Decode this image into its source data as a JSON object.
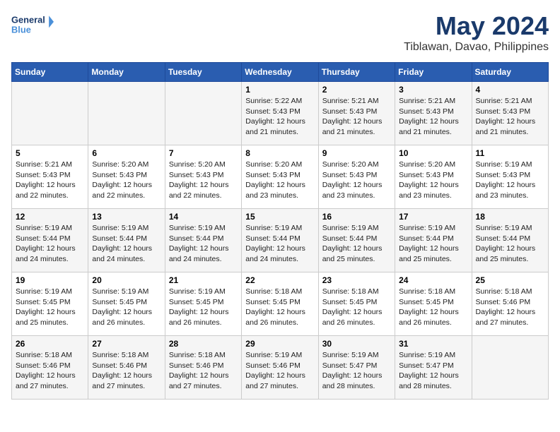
{
  "logo": {
    "line1": "General",
    "line2": "Blue"
  },
  "title": "May 2024",
  "location": "Tiblawan, Davao, Philippines",
  "weekdays": [
    "Sunday",
    "Monday",
    "Tuesday",
    "Wednesday",
    "Thursday",
    "Friday",
    "Saturday"
  ],
  "weeks": [
    [
      {
        "day": "",
        "content": ""
      },
      {
        "day": "",
        "content": ""
      },
      {
        "day": "",
        "content": ""
      },
      {
        "day": "1",
        "content": "Sunrise: 5:22 AM\nSunset: 5:43 PM\nDaylight: 12 hours\nand 21 minutes."
      },
      {
        "day": "2",
        "content": "Sunrise: 5:21 AM\nSunset: 5:43 PM\nDaylight: 12 hours\nand 21 minutes."
      },
      {
        "day": "3",
        "content": "Sunrise: 5:21 AM\nSunset: 5:43 PM\nDaylight: 12 hours\nand 21 minutes."
      },
      {
        "day": "4",
        "content": "Sunrise: 5:21 AM\nSunset: 5:43 PM\nDaylight: 12 hours\nand 21 minutes."
      }
    ],
    [
      {
        "day": "5",
        "content": "Sunrise: 5:21 AM\nSunset: 5:43 PM\nDaylight: 12 hours\nand 22 minutes."
      },
      {
        "day": "6",
        "content": "Sunrise: 5:20 AM\nSunset: 5:43 PM\nDaylight: 12 hours\nand 22 minutes."
      },
      {
        "day": "7",
        "content": "Sunrise: 5:20 AM\nSunset: 5:43 PM\nDaylight: 12 hours\nand 22 minutes."
      },
      {
        "day": "8",
        "content": "Sunrise: 5:20 AM\nSunset: 5:43 PM\nDaylight: 12 hours\nand 23 minutes."
      },
      {
        "day": "9",
        "content": "Sunrise: 5:20 AM\nSunset: 5:43 PM\nDaylight: 12 hours\nand 23 minutes."
      },
      {
        "day": "10",
        "content": "Sunrise: 5:20 AM\nSunset: 5:43 PM\nDaylight: 12 hours\nand 23 minutes."
      },
      {
        "day": "11",
        "content": "Sunrise: 5:19 AM\nSunset: 5:43 PM\nDaylight: 12 hours\nand 23 minutes."
      }
    ],
    [
      {
        "day": "12",
        "content": "Sunrise: 5:19 AM\nSunset: 5:44 PM\nDaylight: 12 hours\nand 24 minutes."
      },
      {
        "day": "13",
        "content": "Sunrise: 5:19 AM\nSunset: 5:44 PM\nDaylight: 12 hours\nand 24 minutes."
      },
      {
        "day": "14",
        "content": "Sunrise: 5:19 AM\nSunset: 5:44 PM\nDaylight: 12 hours\nand 24 minutes."
      },
      {
        "day": "15",
        "content": "Sunrise: 5:19 AM\nSunset: 5:44 PM\nDaylight: 12 hours\nand 24 minutes."
      },
      {
        "day": "16",
        "content": "Sunrise: 5:19 AM\nSunset: 5:44 PM\nDaylight: 12 hours\nand 25 minutes."
      },
      {
        "day": "17",
        "content": "Sunrise: 5:19 AM\nSunset: 5:44 PM\nDaylight: 12 hours\nand 25 minutes."
      },
      {
        "day": "18",
        "content": "Sunrise: 5:19 AM\nSunset: 5:44 PM\nDaylight: 12 hours\nand 25 minutes."
      }
    ],
    [
      {
        "day": "19",
        "content": "Sunrise: 5:19 AM\nSunset: 5:45 PM\nDaylight: 12 hours\nand 25 minutes."
      },
      {
        "day": "20",
        "content": "Sunrise: 5:19 AM\nSunset: 5:45 PM\nDaylight: 12 hours\nand 26 minutes."
      },
      {
        "day": "21",
        "content": "Sunrise: 5:19 AM\nSunset: 5:45 PM\nDaylight: 12 hours\nand 26 minutes."
      },
      {
        "day": "22",
        "content": "Sunrise: 5:18 AM\nSunset: 5:45 PM\nDaylight: 12 hours\nand 26 minutes."
      },
      {
        "day": "23",
        "content": "Sunrise: 5:18 AM\nSunset: 5:45 PM\nDaylight: 12 hours\nand 26 minutes."
      },
      {
        "day": "24",
        "content": "Sunrise: 5:18 AM\nSunset: 5:45 PM\nDaylight: 12 hours\nand 26 minutes."
      },
      {
        "day": "25",
        "content": "Sunrise: 5:18 AM\nSunset: 5:46 PM\nDaylight: 12 hours\nand 27 minutes."
      }
    ],
    [
      {
        "day": "26",
        "content": "Sunrise: 5:18 AM\nSunset: 5:46 PM\nDaylight: 12 hours\nand 27 minutes."
      },
      {
        "day": "27",
        "content": "Sunrise: 5:18 AM\nSunset: 5:46 PM\nDaylight: 12 hours\nand 27 minutes."
      },
      {
        "day": "28",
        "content": "Sunrise: 5:18 AM\nSunset: 5:46 PM\nDaylight: 12 hours\nand 27 minutes."
      },
      {
        "day": "29",
        "content": "Sunrise: 5:19 AM\nSunset: 5:46 PM\nDaylight: 12 hours\nand 27 minutes."
      },
      {
        "day": "30",
        "content": "Sunrise: 5:19 AM\nSunset: 5:47 PM\nDaylight: 12 hours\nand 28 minutes."
      },
      {
        "day": "31",
        "content": "Sunrise: 5:19 AM\nSunset: 5:47 PM\nDaylight: 12 hours\nand 28 minutes."
      },
      {
        "day": "",
        "content": ""
      }
    ]
  ]
}
